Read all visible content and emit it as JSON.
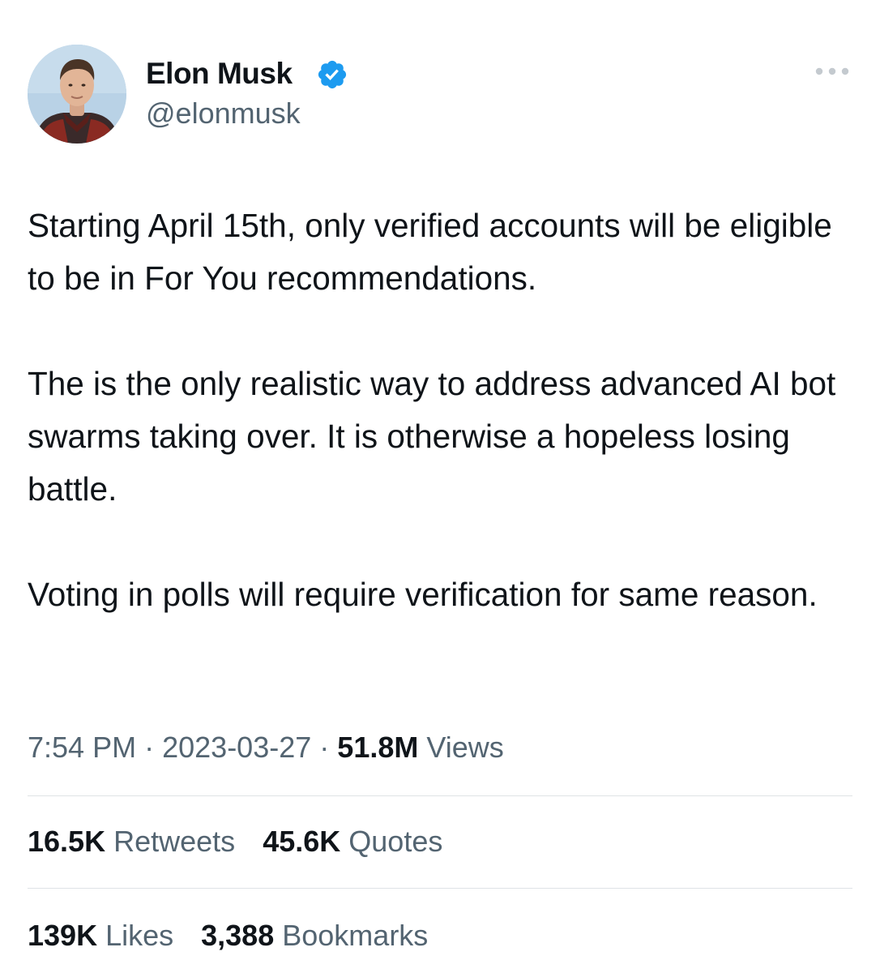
{
  "author": {
    "display_name": "Elon Musk",
    "handle": "@elonmusk",
    "verified": true,
    "verified_color": "#1d9bf0"
  },
  "tweet": {
    "paragraphs": [
      "Starting April 15th, only verified accounts will be eligible to be in For You recommendations.",
      "The is the only realistic way to address advanced AI bot swarms taking over. It is otherwise a hopeless losing battle.",
      "Voting in polls will require verification for same reason."
    ]
  },
  "meta": {
    "time": "7:54 PM",
    "separator": "·",
    "date": "2023-03-27",
    "views_count": "51.8M",
    "views_label": "Views"
  },
  "stats": {
    "retweets_count": "16.5K",
    "retweets_label": "Retweets",
    "quotes_count": "45.6K",
    "quotes_label": "Quotes",
    "likes_count": "139K",
    "likes_label": "Likes",
    "bookmarks_count": "3,388",
    "bookmarks_label": "Bookmarks"
  },
  "icons": {
    "more": "more-horizontal-icon",
    "verified": "verified-badge-icon"
  },
  "colors": {
    "text_primary": "#0f1419",
    "text_secondary": "#536471",
    "divider": "#dfe3e6"
  }
}
